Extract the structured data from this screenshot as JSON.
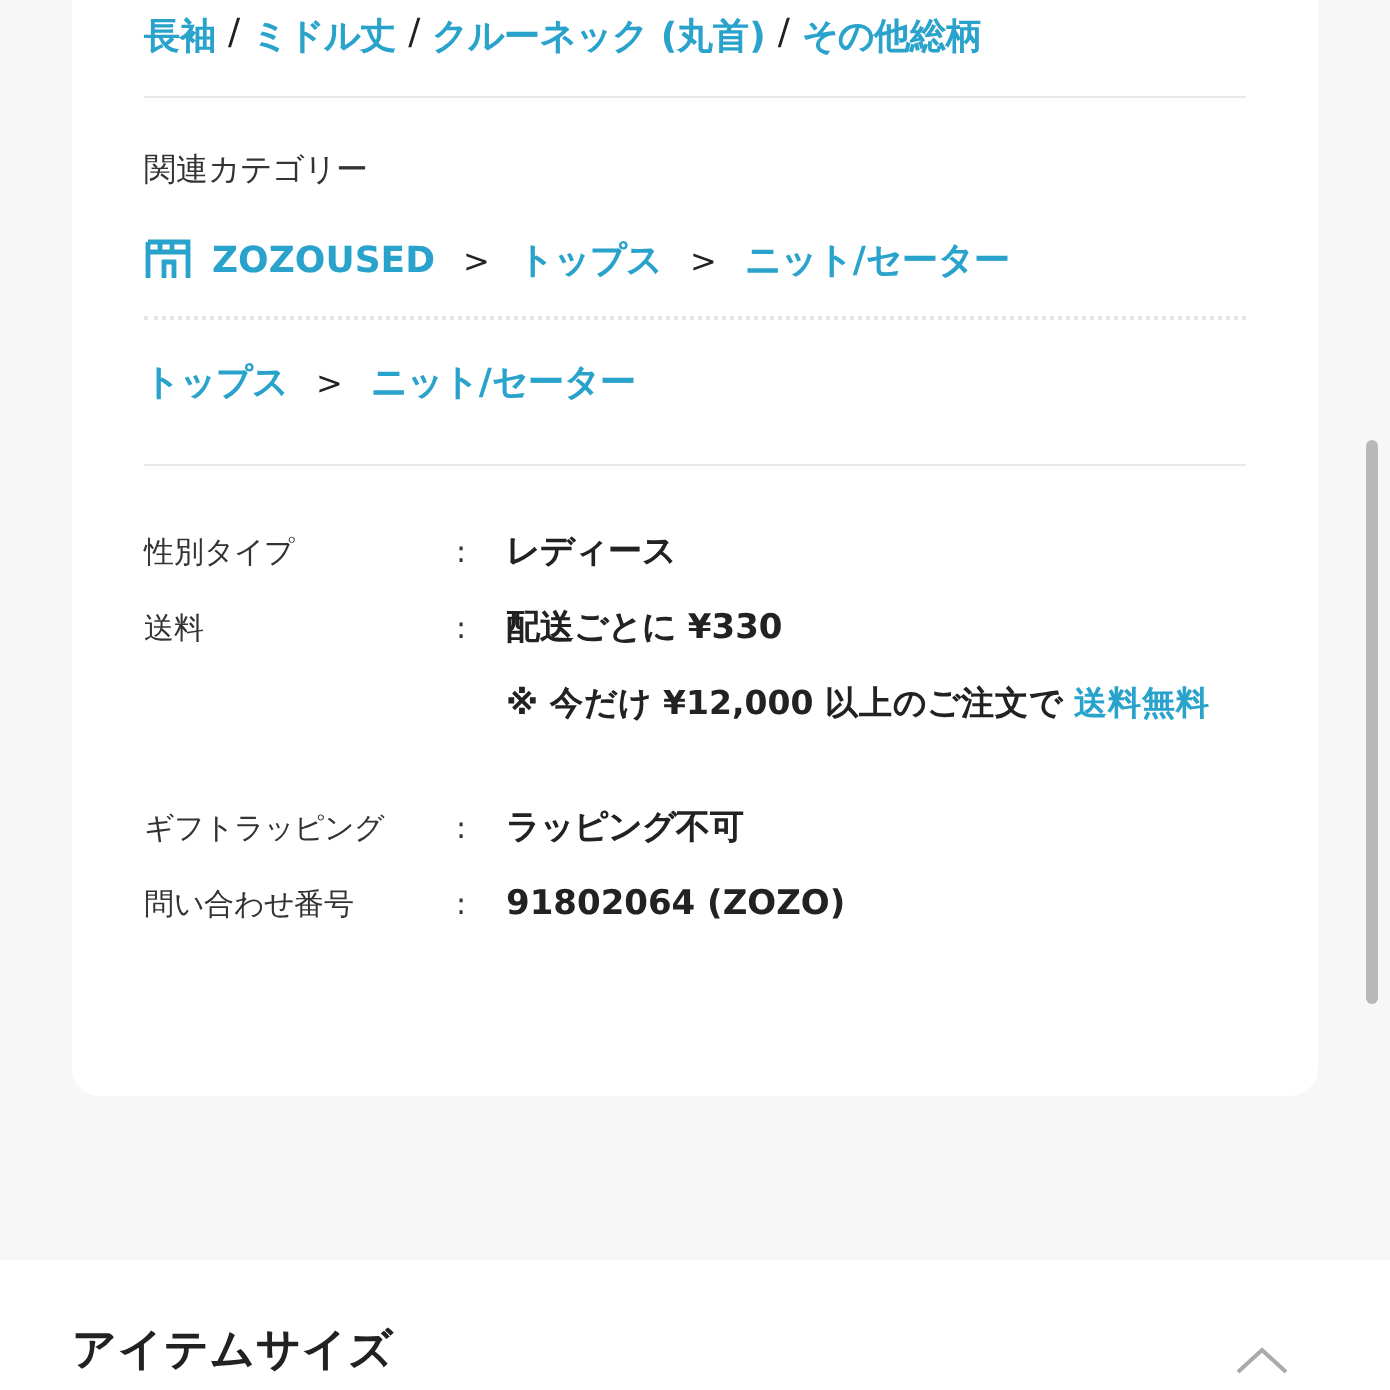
{
  "tags": [
    {
      "kind": "link",
      "text": "長袖"
    },
    {
      "kind": "separator",
      "text": "/"
    },
    {
      "kind": "link",
      "text": "ミドル丈"
    },
    {
      "kind": "separator",
      "text": "/"
    },
    {
      "kind": "link",
      "text": "クルーネック (丸首)"
    },
    {
      "kind": "separator",
      "text": "/"
    },
    {
      "kind": "link",
      "text": "その他総柄"
    }
  ],
  "related_categories": {
    "title": "関連カテゴリー",
    "paths": [
      {
        "kind": "shop",
        "items": [
          {
            "kind": "link",
            "text": "ZOZOUSED"
          },
          {
            "kind": "separator",
            "text": ">"
          },
          {
            "kind": "link",
            "text": "トップス"
          },
          {
            "kind": "separator",
            "text": ">"
          },
          {
            "kind": "link",
            "text": "ニット/セーター"
          }
        ]
      },
      {
        "kind": "plain",
        "items": [
          {
            "kind": "link",
            "text": "トップス"
          },
          {
            "kind": "separator",
            "text": ">"
          },
          {
            "kind": "link",
            "text": "ニット/セーター"
          }
        ]
      }
    ]
  },
  "details": [
    {
      "label": "性別タイプ",
      "colon": ":",
      "value": "レディース"
    },
    {
      "label": "送料",
      "colon": ":",
      "value": "配送ごとに ¥330",
      "note": "※ 今だけ ¥12,000 以上のご注文で ",
      "note_link": "送料無料"
    },
    {
      "label": "ギフトラッピング",
      "colon": ":",
      "value": "ラッピング不可"
    },
    {
      "label": "問い合わせ番号",
      "colon": ":",
      "value": "91802064 (ZOZO)"
    }
  ],
  "next_section": {
    "title": "アイテムサイズ",
    "expanded": true
  }
}
